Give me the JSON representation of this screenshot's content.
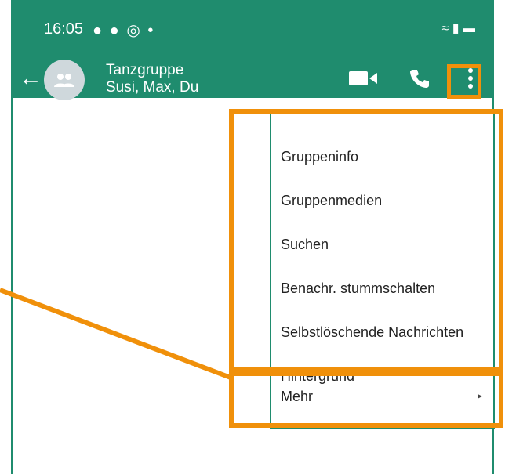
{
  "status_bar": {
    "time": "16:05",
    "left_icons": [
      "facebook-icon",
      "facebook-icon",
      "camera-icon"
    ],
    "dot": "•",
    "right_icons": [
      "wifi-icon",
      "signal-icon",
      "battery-icon"
    ]
  },
  "app_bar": {
    "title": "Tanzgruppe",
    "subtitle": "Susi, Max, Du",
    "actions": [
      "video-call-icon",
      "voice-call-icon",
      "more-options-icon"
    ]
  },
  "menu": {
    "items": [
      {
        "label": "Gruppeninfo"
      },
      {
        "label": "Gruppenmedien"
      },
      {
        "label": "Suchen"
      },
      {
        "label": "Benachr. stummschalten"
      },
      {
        "label": "Selbstlöschende Nachrichten"
      },
      {
        "label": "Hintergrund"
      },
      {
        "label": "Mehr",
        "has_submenu": true
      }
    ]
  },
  "colors": {
    "header": "#1f8c6e",
    "highlight": "#f0900a",
    "menu_text": "#222222"
  }
}
